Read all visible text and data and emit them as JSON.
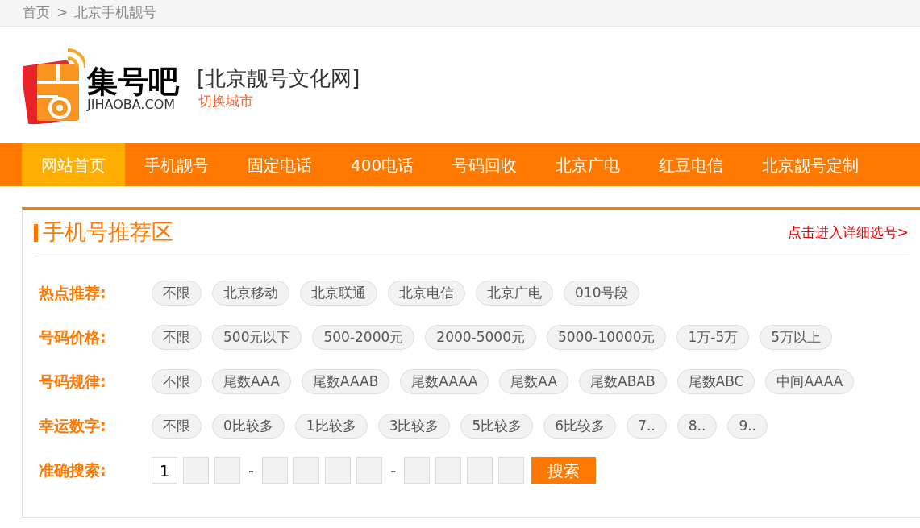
{
  "breadcrumb": {
    "items": [
      "首页",
      "北京手机靓号"
    ],
    "separator": ">"
  },
  "header": {
    "logo": {
      "name": "集号吧",
      "domain": "JIHAOBA.COM"
    },
    "site_title": "[北京靓号文化网]",
    "switch_city": "切换城市"
  },
  "nav": [
    {
      "label": "网站首页",
      "selected": true
    },
    {
      "label": "手机靓号",
      "selected": false
    },
    {
      "label": "固定电话",
      "selected": false
    },
    {
      "label": "400电话",
      "selected": false
    },
    {
      "label": "号码回收",
      "selected": false
    },
    {
      "label": "北京广电",
      "selected": false
    },
    {
      "label": "红豆电信",
      "selected": false
    },
    {
      "label": "北京靓号定制",
      "selected": false
    }
  ],
  "panel": {
    "title": "手机号推荐区",
    "detail_link": "点击进入详细选号>",
    "filters": [
      {
        "label": "热点推荐:",
        "options": [
          "不限",
          "北京移动",
          "北京联通",
          "北京电信",
          "北京广电",
          "010号段"
        ]
      },
      {
        "label": "号码价格:",
        "options": [
          "不限",
          "500元以下",
          "500-2000元",
          "2000-5000元",
          "5000-10000元",
          "1万-5万",
          "5万以上"
        ]
      },
      {
        "label": "号码规律:",
        "options": [
          "不限",
          "尾数AAA",
          "尾数AAAB",
          "尾数AAAA",
          "尾数AA",
          "尾数ABAB",
          "尾数ABC",
          "中间AAAA"
        ]
      },
      {
        "label": "幸运数字:",
        "options": [
          "不限",
          "0比较多",
          "1比较多",
          "3比较多",
          "5比较多",
          "6比较多",
          "7..",
          "8..",
          "9.."
        ]
      }
    ],
    "search": {
      "label": "准确搜索:",
      "digit_groups": [
        [
          {
            "kind": "filled",
            "value": "1"
          },
          {
            "kind": "empty"
          },
          {
            "kind": "empty"
          }
        ],
        [
          {
            "kind": "empty"
          },
          {
            "kind": "empty"
          },
          {
            "kind": "empty"
          },
          {
            "kind": "empty"
          }
        ],
        [
          {
            "kind": "empty"
          },
          {
            "kind": "empty"
          },
          {
            "kind": "empty"
          },
          {
            "kind": "empty"
          }
        ]
      ],
      "separators": [
        "-",
        "-"
      ],
      "button": "搜索"
    }
  }
}
